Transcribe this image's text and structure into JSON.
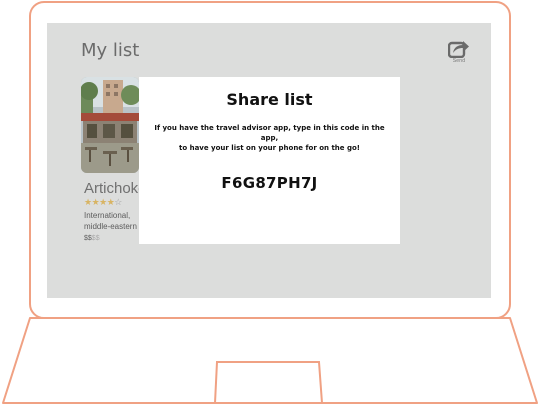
{
  "header": {
    "title": "My list",
    "send_label": "Send"
  },
  "card": {
    "title": "Artichoke",
    "rating_filled": 4,
    "rating_total": 5,
    "stars_filled": "★★★★",
    "stars_empty": "☆",
    "tags_line1": "International,",
    "tags_line2": "middle-eastern",
    "price_active": "$$",
    "price_inactive": "$$"
  },
  "dialog": {
    "title": "Share list",
    "message_line1": "If you have the travel advisor app, type in this code in the app,",
    "message_line2": "to have your list on your phone for on the go!",
    "code": "F6G87PH7J"
  },
  "colors": {
    "frame": "#f0a183",
    "screen_bg": "#dcdddc",
    "star": "#d8b463"
  },
  "icons": {
    "send": "share-arrow-icon"
  }
}
